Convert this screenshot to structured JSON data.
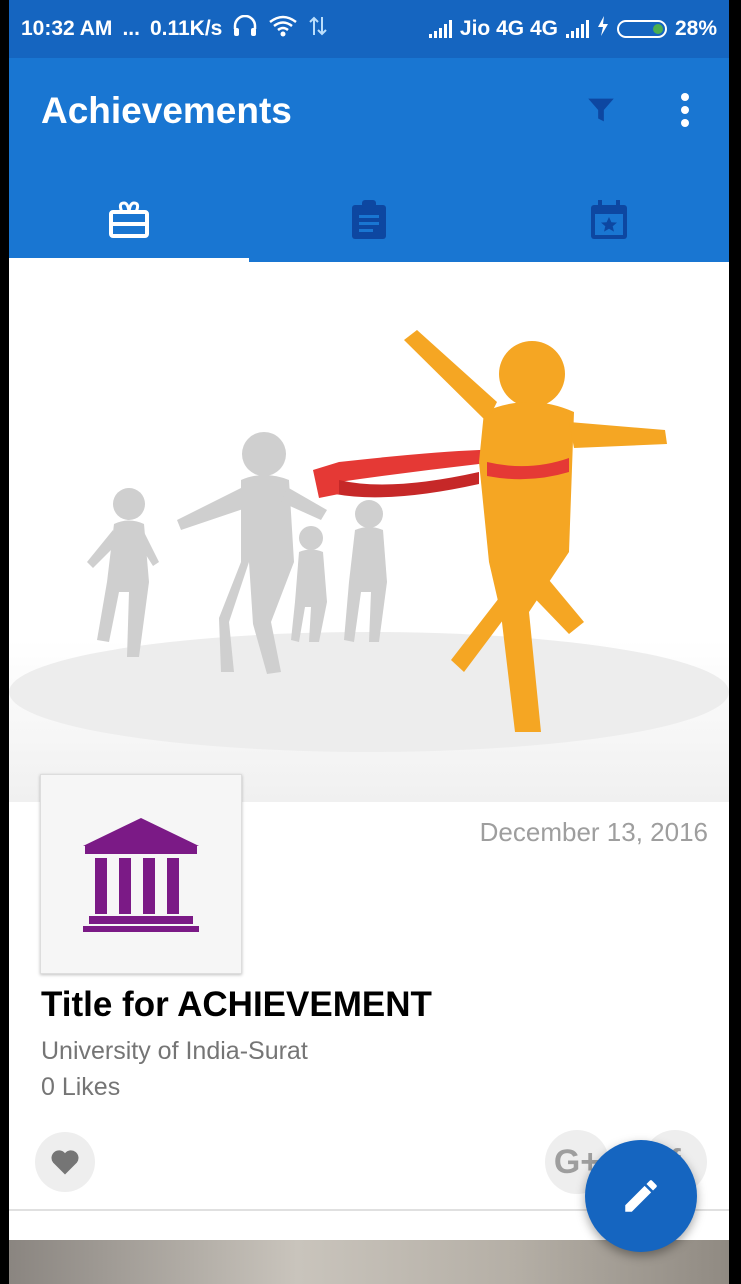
{
  "status_bar": {
    "time": "10:32 AM",
    "dots": "...",
    "speed": "0.11K/s",
    "carrier": "Jio 4G 4G",
    "battery": "28%"
  },
  "app_bar": {
    "title": "Achievements",
    "tabs": [
      {
        "icon": "gift-card-icon",
        "active": true
      },
      {
        "icon": "clipboard-icon",
        "active": false
      },
      {
        "icon": "calendar-star-icon",
        "active": false
      }
    ]
  },
  "card": {
    "date": "December 13, 2016",
    "title": "Title for ACHIEVEMENT",
    "institution": "University of India-Surat",
    "likes": "0 Likes",
    "share_google": "G+",
    "share_facebook": "f"
  },
  "colors": {
    "primary": "#1976D2",
    "primary_dark": "#1565C0",
    "logo_purple": "#7B1A86",
    "runner_orange": "#F5A623"
  }
}
